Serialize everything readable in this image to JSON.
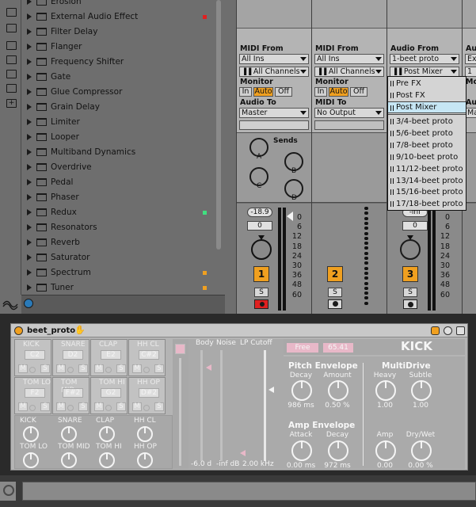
{
  "browser": {
    "items": [
      {
        "label": "Erosion",
        "dot": ""
      },
      {
        "label": "External Audio Effect",
        "dot": "#e02020"
      },
      {
        "label": "Filter Delay",
        "dot": ""
      },
      {
        "label": "Flanger",
        "dot": ""
      },
      {
        "label": "Frequency Shifter",
        "dot": ""
      },
      {
        "label": "Gate",
        "dot": ""
      },
      {
        "label": "Glue Compressor",
        "dot": ""
      },
      {
        "label": "Grain Delay",
        "dot": ""
      },
      {
        "label": "Limiter",
        "dot": ""
      },
      {
        "label": "Looper",
        "dot": ""
      },
      {
        "label": "Multiband Dynamics",
        "dot": ""
      },
      {
        "label": "Overdrive",
        "dot": ""
      },
      {
        "label": "Pedal",
        "dot": ""
      },
      {
        "label": "Phaser",
        "dot": ""
      },
      {
        "label": "Redux",
        "dot": "#40e080"
      },
      {
        "label": "Resonators",
        "dot": ""
      },
      {
        "label": "Reverb",
        "dot": ""
      },
      {
        "label": "Saturator",
        "dot": ""
      },
      {
        "label": "Spectrum",
        "dot": "#f0a020"
      },
      {
        "label": "Tuner",
        "dot": "#f0a020"
      }
    ]
  },
  "tracks": [
    {
      "midi_from_label": "MIDI From",
      "midi_from": "All Ins",
      "channel": "All Channels",
      "monitor_label": "Monitor",
      "monitor": [
        "In",
        "Auto",
        "Off"
      ],
      "audio_to_label": "Audio To",
      "audio_to": "Master",
      "sends_label": "Sends",
      "send_labels": [
        "A",
        "B",
        "C",
        "D"
      ],
      "volume": "-18.9",
      "pan": "0",
      "number": "1",
      "solo": "S"
    },
    {
      "midi_from_label": "MIDI From",
      "midi_from": "All Ins",
      "channel": "All Channels",
      "monitor_label": "Monitor",
      "monitor": [
        "In",
        "Auto",
        "Off"
      ],
      "audio_to_label": "MIDI To",
      "audio_to": "No Output",
      "number": "2",
      "solo": "S"
    },
    {
      "midi_from_label": "Audio From",
      "midi_from": "1-beet proto",
      "channel": "Post Mixer",
      "volume": "-inf",
      "pan": "0",
      "number": "3",
      "solo": "S"
    },
    {
      "midi_from_label": "Au",
      "midi_from": "Ext",
      "channel": "1",
      "monitor_label": "Mo",
      "audio_to_label": "Au",
      "audio_to": "Ma"
    }
  ],
  "meter_scale": [
    "0",
    "6",
    "12",
    "18",
    "24",
    "30",
    "36",
    "48",
    "60"
  ],
  "meter_scale_2": [
    "0",
    "6",
    "12",
    "18",
    "24",
    "30",
    "36",
    "48",
    "60"
  ],
  "dropdown": {
    "options_top": [
      "Pre FX",
      "Post FX",
      "Post Mixer"
    ],
    "selected": "Post Mixer",
    "options_bottom": [
      "3/4-beet proto",
      "5/6-beet proto",
      "7/8-beet proto",
      "9/10-beet proto",
      "11/12-beet proto",
      "13/14-beet proto",
      "15/16-beet proto",
      "17/18-beet proto"
    ]
  },
  "device": {
    "title": "beet_proto",
    "pads": [
      {
        "name": "KICK",
        "note": "C2"
      },
      {
        "name": "SNARE",
        "note": "D2"
      },
      {
        "name": "CLAP",
        "note": "E2"
      },
      {
        "name": "HH CL",
        "note": "C#2"
      },
      {
        "name": "TOM LO",
        "note": "F2"
      },
      {
        "name": "TOM MID",
        "note": "F#2"
      },
      {
        "name": "TOM HI",
        "note": "G2"
      },
      {
        "name": "HH OP",
        "note": "D#2"
      }
    ],
    "mute_label": "M",
    "solo_label": "S",
    "knob_labels": [
      "KICK",
      "SNARE",
      "CLAP",
      "HH CL",
      "TOM LO",
      "TOM MID",
      "TOM HI",
      "HH OP"
    ],
    "strip_labels": [
      "Body",
      "Noise",
      "LP Cutoff"
    ],
    "strip_values": [
      "-6.0 d",
      "-inf dB",
      "2.00 kHz"
    ],
    "mode": "Free",
    "freq": "65.41",
    "instrument": "KICK",
    "pitch_env": {
      "title": "Pitch Envelope",
      "decay_label": "Decay",
      "decay": "986 ms",
      "amount_label": "Amount",
      "amount": "0.50 %"
    },
    "multidrive": {
      "title": "MultiDrive",
      "heavy_label": "Heavy",
      "heavy": "1.00",
      "subtle_label": "Subtle",
      "subtle": "1.00"
    },
    "amp_env": {
      "title": "Amp Envelope",
      "attack_label": "Attack",
      "attack": "0.00 ms",
      "decay_label": "Decay",
      "decay": "972 ms"
    },
    "amp": {
      "amp_label": "Amp",
      "amp": "0.00",
      "drywet_label": "Dry/Wet",
      "drywet": "0.00 %"
    }
  },
  "colors": {
    "accent": "#f0a020",
    "selected_blue": "#c6e6f4",
    "rec_red": "#e02020"
  }
}
